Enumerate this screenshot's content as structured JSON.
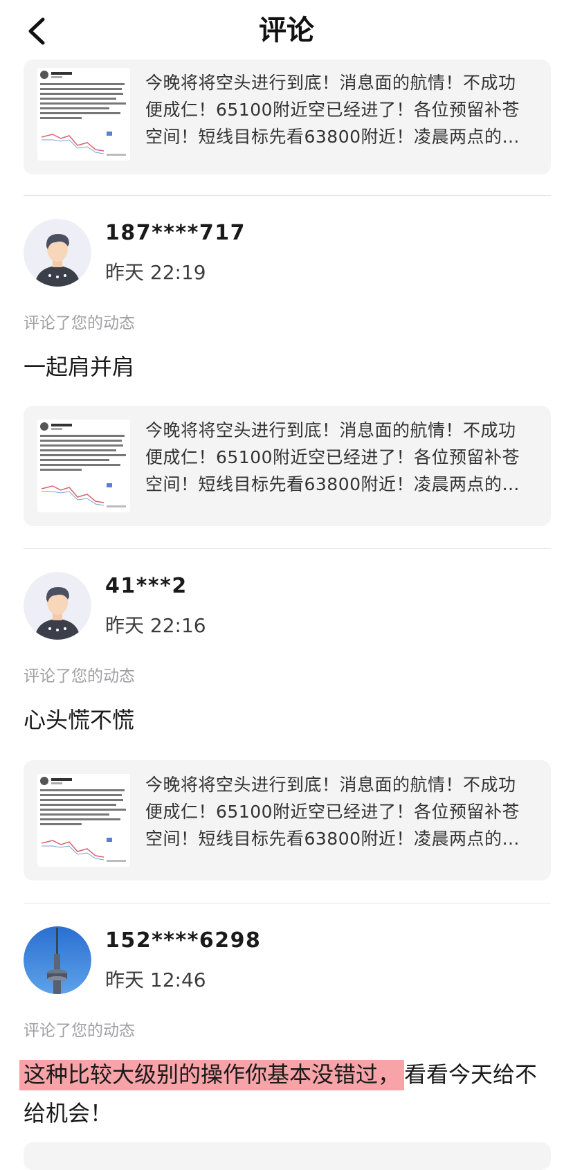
{
  "header": {
    "title": "评论"
  },
  "post": {
    "text": "今晚将将空头进行到底！消息面的航情！不成功便成仁！65100附近空已经进了！各位预留补苍空间！短线目标先看63800附近！凌晨两点的会议...",
    "thumb_author": "波段王清瑞"
  },
  "action_label": "评论了您的动态",
  "comments": [
    {
      "user": "187****717",
      "time": "昨天 22:19",
      "text": "一起肩并肩"
    },
    {
      "user": "41***2",
      "time": "昨天 22:16",
      "text": "心头慌不慌"
    },
    {
      "user": "152****6298",
      "time": "昨天 12:46",
      "text_highlight": "这种比较大级别的操作你基本没错过，",
      "text_rest": "看看今天给不给机会！"
    }
  ]
}
